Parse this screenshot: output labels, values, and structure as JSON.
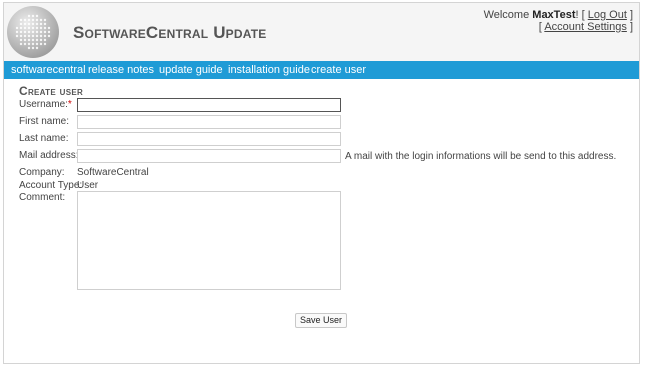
{
  "header": {
    "app_title": "SoftwareCentral Update",
    "welcome_text": "Welcome",
    "username": "MaxTest",
    "exclaim": "!",
    "logout_label": "Log Out",
    "account_settings_label": "Account Settings",
    "bracket_open": "[",
    "bracket_close": "]",
    "logo_icon": "grid-logo-icon"
  },
  "nav": {
    "items": [
      {
        "label": "softwarecentral"
      },
      {
        "label": "release notes"
      },
      {
        "label": "update guide"
      },
      {
        "label": "installation guide"
      },
      {
        "label": "create user"
      }
    ]
  },
  "form": {
    "heading": "Create user",
    "required_marker": "*",
    "username_label": "Username:",
    "username_value": "",
    "firstname_label": "First name:",
    "firstname_value": "",
    "lastname_label": "Last name:",
    "lastname_value": "",
    "mail_label": "Mail address:",
    "mail_value": "",
    "mail_hint": "A mail with the login informations will be send to this address.",
    "company_label": "Company:",
    "company_value": "SoftwareCentral",
    "account_type_label": "Account Type:",
    "account_type_value": "User",
    "comment_label": "Comment:",
    "comment_value": "",
    "save_label": "Save User"
  },
  "colors": {
    "accent": "#1f9bd6",
    "required": "#cc0000",
    "header_bg": "#f5f5f5"
  }
}
